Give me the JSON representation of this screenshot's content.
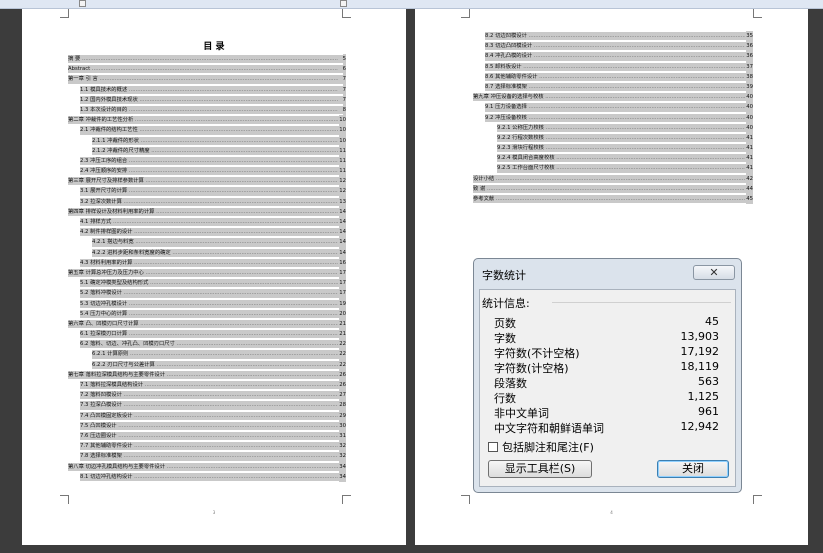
{
  "left_page": {
    "title": "目    录",
    "entries": [
      {
        "text": "摘    要",
        "page": "5",
        "level": 0
      },
      {
        "text": "Abstract",
        "page": "6",
        "level": 0
      },
      {
        "text": "第一章  引    言",
        "page": "7",
        "level": 0
      },
      {
        "text": "1.1 模具技术的概述",
        "page": "7",
        "level": 1
      },
      {
        "text": "1.2 国内外模具技术现状",
        "page": "7",
        "level": 1
      },
      {
        "text": "1.3 本次设计的目的",
        "page": "8",
        "level": 1
      },
      {
        "text": "第二章  冲裁件的工艺性分析",
        "page": "10",
        "level": 0
      },
      {
        "text": "2.1 冲裁件的结构工艺性",
        "page": "10",
        "level": 1
      },
      {
        "text": "2.1.1 冲裁件的形状",
        "page": "10",
        "level": 2
      },
      {
        "text": "2.1.2 冲裁件的尺寸精度",
        "page": "11",
        "level": 2
      },
      {
        "text": "2.3 冲压工序的组合",
        "page": "11",
        "level": 1
      },
      {
        "text": "2.4 冲压顺序的安排",
        "page": "11",
        "level": 1
      },
      {
        "text": "第三章  展开尺寸及排样参数计算",
        "page": "12",
        "level": 0
      },
      {
        "text": "3.1 展开尺寸的计算",
        "page": "12",
        "level": 1
      },
      {
        "text": "3.2 拉深次数计算",
        "page": "13",
        "level": 1
      },
      {
        "text": "第四章  排样设计及材料利用率的计算",
        "page": "14",
        "level": 0
      },
      {
        "text": "4.1 排样方式",
        "page": "14",
        "level": 1
      },
      {
        "text": "4.2 制件排样图的设计",
        "page": "14",
        "level": 1
      },
      {
        "text": "4.2.1 搭边与料宽",
        "page": "14",
        "level": 2
      },
      {
        "text": "4.2.2 进料步距和条料宽度的确定",
        "page": "14",
        "level": 2
      },
      {
        "text": "4.3 材料利用率的计算",
        "page": "16",
        "level": 1
      },
      {
        "text": "第五章  计算总冲压力及压力中心",
        "page": "17",
        "level": 0
      },
      {
        "text": "5.1 确定冲模类型及结构形式",
        "page": "17",
        "level": 1
      },
      {
        "text": "5.2 落料冲模设计",
        "page": "17",
        "level": 1
      },
      {
        "text": "5.3 切边冲孔模设计",
        "page": "19",
        "level": 1
      },
      {
        "text": "5.4 压力中心的计算",
        "page": "20",
        "level": 1
      },
      {
        "text": "第六章  凸、凹模刃口尺寸计算",
        "page": "21",
        "level": 0
      },
      {
        "text": "6.1 拉深模刃口计算",
        "page": "21",
        "level": 1
      },
      {
        "text": "6.2 落料、切边、冲孔凸、凹模刃口尺寸",
        "page": "22",
        "level": 1
      },
      {
        "text": "6.2.1 计算原则",
        "page": "22",
        "level": 2
      },
      {
        "text": "6.2.2 刃口尺寸与公差计算",
        "page": "22",
        "level": 2
      },
      {
        "text": "第七章  落料拉深模具结构与主要零件设计",
        "page": "26",
        "level": 0
      },
      {
        "text": "7.1 落料拉深模具结构设计",
        "page": "26",
        "level": 1
      },
      {
        "text": "7.2 落料凹模设计",
        "page": "27",
        "level": 1
      },
      {
        "text": "7.3 拉深凸模设计",
        "page": "28",
        "level": 1
      },
      {
        "text": "7.4 凸凹模固定板设计",
        "page": "29",
        "level": 1
      },
      {
        "text": "7.5 凸凹模设计",
        "page": "30",
        "level": 1
      },
      {
        "text": "7.6 压边圈设计",
        "page": "31",
        "level": 1
      },
      {
        "text": "7.7 其他辅助零件设计",
        "page": "32",
        "level": 1
      },
      {
        "text": "7.8 选择标准模架",
        "page": "32",
        "level": 1
      },
      {
        "text": "第八章  切边冲孔模具结构与主要零件设计",
        "page": "34",
        "level": 0
      },
      {
        "text": "8.1 切边冲孔结构设计",
        "page": "34",
        "level": 1
      }
    ],
    "page_number": "3"
  },
  "right_page": {
    "entries": [
      {
        "text": "8.2 切边凹模设计",
        "page": "35",
        "level": 1
      },
      {
        "text": "8.3 切边凸凹模设计",
        "page": "36",
        "level": 1
      },
      {
        "text": "8.4 冲孔凸模的设计",
        "page": "36",
        "level": 1
      },
      {
        "text": "8.5 卸料板设计",
        "page": "37",
        "level": 1
      },
      {
        "text": "8.6 其他辅助零件设计",
        "page": "38",
        "level": 1
      },
      {
        "text": "8.7 选择标准模架",
        "page": "39",
        "level": 1
      },
      {
        "text": "第九章  冲压设备的选择与校核",
        "page": "40",
        "level": 0
      },
      {
        "text": "9.1 压力设备选择",
        "page": "40",
        "level": 1
      },
      {
        "text": "9.2 冲压设备校核",
        "page": "40",
        "level": 1
      },
      {
        "text": "9.2.1 公称压力校核",
        "page": "40",
        "level": 2
      },
      {
        "text": "9.2.2 行程次数校核",
        "page": "41",
        "level": 2
      },
      {
        "text": "9.2.3 滑块行程校核",
        "page": "41",
        "level": 2
      },
      {
        "text": "9.2.4 模具闭合高度校核",
        "page": "41",
        "level": 2
      },
      {
        "text": "9.2.5 工作台面尺寸校核",
        "page": "41",
        "level": 2
      },
      {
        "text": "设计小结",
        "page": "42",
        "level": 0
      },
      {
        "text": "致    谢",
        "page": "44",
        "level": 0
      },
      {
        "text": "参考文献",
        "page": "45",
        "level": 0
      }
    ],
    "page_number": "4"
  },
  "dialog": {
    "title": "字数统计",
    "close_icon": "close-icon",
    "group_label": "统计信息:",
    "stats": [
      {
        "label": "页数",
        "value": "45"
      },
      {
        "label": "字数",
        "value": "13,903"
      },
      {
        "label": "字符数(不计空格)",
        "value": "17,192"
      },
      {
        "label": "字符数(计空格)",
        "value": "18,119"
      },
      {
        "label": "段落数",
        "value": "563"
      },
      {
        "label": "行数",
        "value": "1,125"
      },
      {
        "label": "非中文单词",
        "value": "961"
      },
      {
        "label": "中文字符和朝鲜语单词",
        "value": "12,942"
      }
    ],
    "checkbox_label": "包括脚注和尾注(F)",
    "toolbar_button": "显示工具栏(S)",
    "close_button": "关闭"
  },
  "colors": {
    "highlight": "#c9c9c9",
    "background": "#3c3c3c",
    "dialog_frame": "#dbe3ec"
  }
}
